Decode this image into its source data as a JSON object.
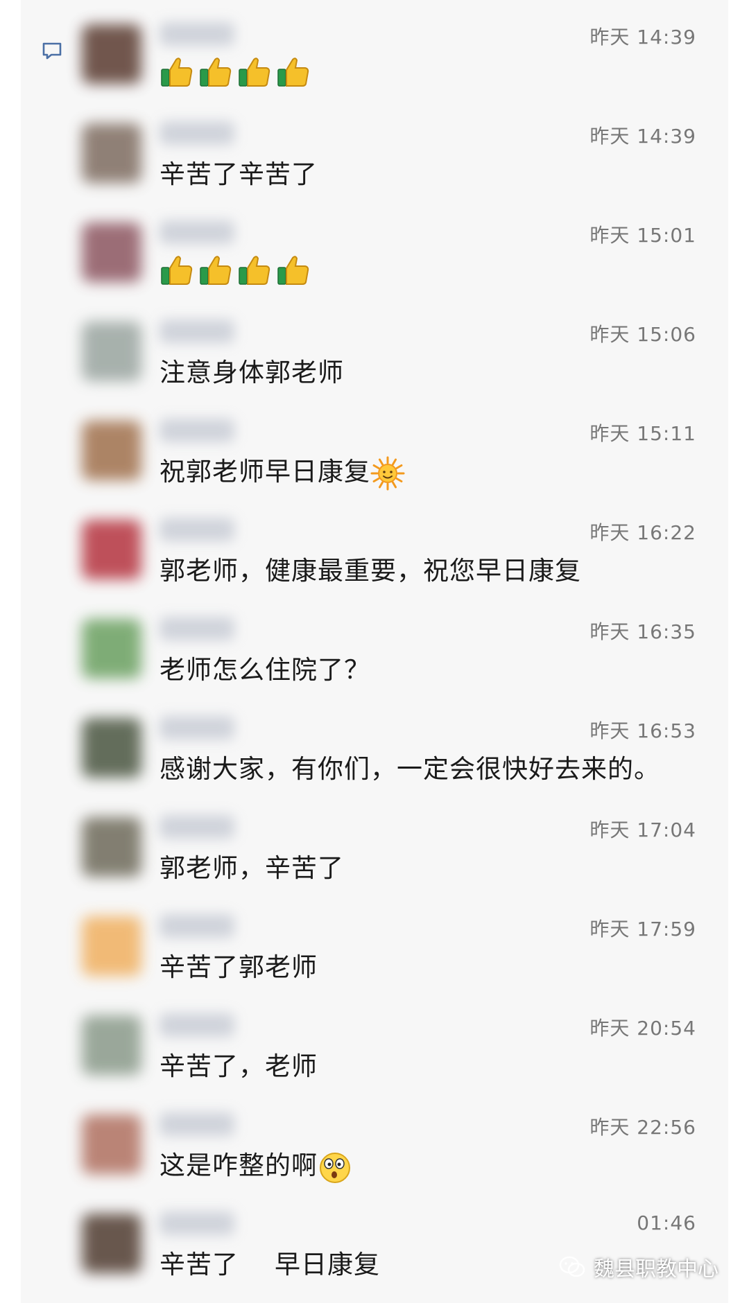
{
  "colors": {
    "panel_bg": "#f7f7f7",
    "timestamp": "#777777",
    "message_text": "#1a1a1a"
  },
  "messages": [
    {
      "time": "昨天 14:39",
      "content": "",
      "emoji": [
        "thumbs-up",
        "thumbs-up",
        "thumbs-up",
        "thumbs-up"
      ],
      "avatar_color": "#5a3b30"
    },
    {
      "time": "昨天 14:39",
      "content": "辛苦了辛苦了",
      "emoji": [],
      "avatar_color": "#7e6c60"
    },
    {
      "time": "昨天 15:01",
      "content": "",
      "emoji": [
        "thumbs-up",
        "thumbs-up",
        "thumbs-up",
        "thumbs-up"
      ],
      "avatar_color": "#8c5560"
    },
    {
      "time": "昨天 15:06",
      "content": "注意身体郭老师",
      "emoji": [],
      "avatar_color": "#9aa5a0"
    },
    {
      "time": "昨天 15:11",
      "content": "祝郭老师早日康复",
      "emoji": [
        "sun"
      ],
      "avatar_color": "#a0704c"
    },
    {
      "time": "昨天 16:22",
      "content": "郭老师，健康最重要，祝您早日康复",
      "emoji": [],
      "avatar_color": "#b5343f"
    },
    {
      "time": "昨天 16:35",
      "content": "老师怎么住院了？",
      "emoji": [],
      "avatar_color": "#6aa060"
    },
    {
      "time": "昨天 16:53",
      "content": "感谢大家，有你们，一定会很快好去来的。",
      "emoji": [],
      "avatar_color": "#4a5540"
    },
    {
      "time": "昨天 17:04",
      "content": "郭老师，辛苦了",
      "emoji": [],
      "avatar_color": "#6e6a5a"
    },
    {
      "time": "昨天 17:59",
      "content": "辛苦了郭老师",
      "emoji": [],
      "avatar_color": "#f0b060"
    },
    {
      "time": "昨天 20:54",
      "content": "辛苦了，老师",
      "emoji": [],
      "avatar_color": "#8a9a8a"
    },
    {
      "time": "昨天 22:56",
      "content": "这是咋整的啊",
      "emoji": [
        "surprised"
      ],
      "avatar_color": "#b07060"
    },
    {
      "time": "01:46",
      "content": "辛苦了",
      "content_after_gap": "早日康复",
      "emoji": [],
      "avatar_color": "#503c30"
    }
  ],
  "watermark": {
    "text": "魏县职教中心",
    "icon": "wechat-icon"
  },
  "icons": {
    "comment": "comment-icon",
    "thumb": "thumbs-up-icon",
    "sun": "sun-icon",
    "surprised": "surprised-face-icon"
  }
}
